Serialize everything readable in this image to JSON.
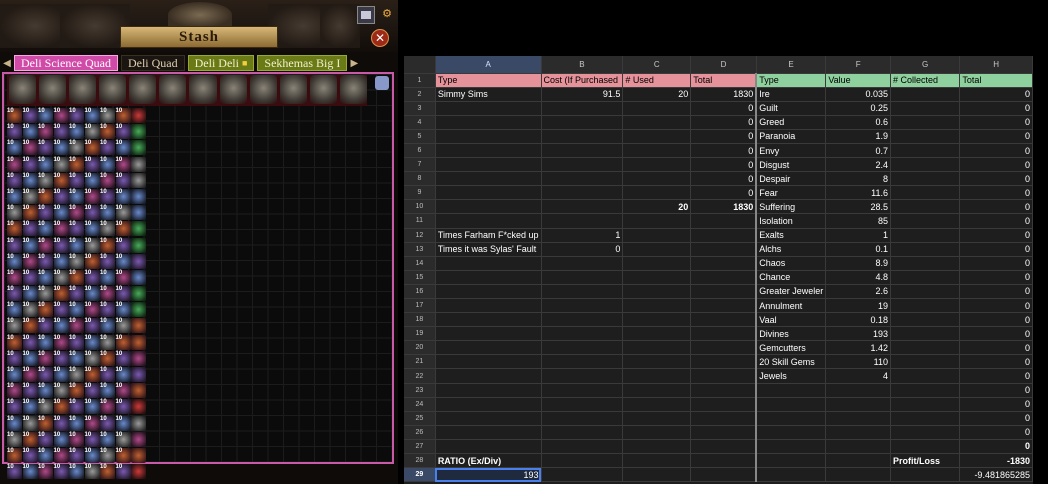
{
  "stash": {
    "title": "Stash",
    "tabs": [
      "Deli Science Quad",
      "Deli Quad",
      "Deli Deli",
      "Sekhemas Big I"
    ],
    "tab_colors": [
      "#d04aa8",
      "#1a1510",
      "#6a7a14",
      "#6a7a14"
    ],
    "close_icon": "close-icon",
    "item_label": "10"
  },
  "sheet": {
    "columns": [
      "",
      "A",
      "B",
      "C",
      "D",
      "E",
      "F",
      "G",
      "H"
    ],
    "selected_column": "A",
    "selected_row": "29",
    "rows": [
      {
        "n": "1",
        "a": "Type",
        "b": "Cost (If Purchased",
        "c": "# Used",
        "d": "Total",
        "e": "Type",
        "f": "Value",
        "g": "# Collected",
        "h": "Total"
      },
      {
        "n": "2",
        "a": "Simmy Sims",
        "b": "91.5",
        "c": "20",
        "d": "1830",
        "e": "Ire",
        "f": "0.035",
        "g": "",
        "h": "0"
      },
      {
        "n": "3",
        "a": "",
        "b": "",
        "c": "",
        "d": "0",
        "e": "Guilt",
        "f": "0.25",
        "g": "",
        "h": "0"
      },
      {
        "n": "4",
        "a": "",
        "b": "",
        "c": "",
        "d": "0",
        "e": "Greed",
        "f": "0.6",
        "g": "",
        "h": "0"
      },
      {
        "n": "5",
        "a": "",
        "b": "",
        "c": "",
        "d": "0",
        "e": "Paranoia",
        "f": "1.9",
        "g": "",
        "h": "0"
      },
      {
        "n": "6",
        "a": "",
        "b": "",
        "c": "",
        "d": "0",
        "e": "Envy",
        "f": "0.7",
        "g": "",
        "h": "0"
      },
      {
        "n": "7",
        "a": "",
        "b": "",
        "c": "",
        "d": "0",
        "e": "Disgust",
        "f": "2.4",
        "g": "",
        "h": "0"
      },
      {
        "n": "8",
        "a": "",
        "b": "",
        "c": "",
        "d": "0",
        "e": "Despair",
        "f": "8",
        "g": "",
        "h": "0"
      },
      {
        "n": "9",
        "a": "",
        "b": "",
        "c": "",
        "d": "0",
        "e": "Fear",
        "f": "11.6",
        "g": "",
        "h": "0"
      },
      {
        "n": "10",
        "a": "",
        "b": "",
        "c": "20",
        "d": "1830",
        "e": "Suffering",
        "f": "28.5",
        "g": "",
        "h": "0"
      },
      {
        "n": "11",
        "a": "",
        "b": "",
        "c": "",
        "d": "",
        "e": "Isolation",
        "f": "85",
        "g": "",
        "h": "0"
      },
      {
        "n": "12",
        "a": "Times Farham F*cked up",
        "b": "1",
        "c": "",
        "d": "",
        "e": "Exalts",
        "f": "1",
        "g": "",
        "h": "0"
      },
      {
        "n": "13",
        "a": "Times it was Sylas' Fault",
        "b": "0",
        "c": "",
        "d": "",
        "e": "Alchs",
        "f": "0.1",
        "g": "",
        "h": "0"
      },
      {
        "n": "14",
        "a": "",
        "b": "",
        "c": "",
        "d": "",
        "e": "Chaos",
        "f": "8.9",
        "g": "",
        "h": "0"
      },
      {
        "n": "15",
        "a": "",
        "b": "",
        "c": "",
        "d": "",
        "e": "Chance",
        "f": "4.8",
        "g": "",
        "h": "0"
      },
      {
        "n": "16",
        "a": "",
        "b": "",
        "c": "",
        "d": "",
        "e": "Greater Jeweler",
        "f": "2.6",
        "g": "",
        "h": "0"
      },
      {
        "n": "17",
        "a": "",
        "b": "",
        "c": "",
        "d": "",
        "e": "Annulment",
        "f": "19",
        "g": "",
        "h": "0"
      },
      {
        "n": "18",
        "a": "",
        "b": "",
        "c": "",
        "d": "",
        "e": "Vaal",
        "f": "0.18",
        "g": "",
        "h": "0"
      },
      {
        "n": "19",
        "a": "",
        "b": "",
        "c": "",
        "d": "",
        "e": "Divines",
        "f": "193",
        "g": "",
        "h": "0"
      },
      {
        "n": "20",
        "a": "",
        "b": "",
        "c": "",
        "d": "",
        "e": "Gemcutters",
        "f": "1.42",
        "g": "",
        "h": "0"
      },
      {
        "n": "21",
        "a": "",
        "b": "",
        "c": "",
        "d": "",
        "e": "20 Skill Gems",
        "f": "110",
        "g": "",
        "h": "0"
      },
      {
        "n": "22",
        "a": "",
        "b": "",
        "c": "",
        "d": "",
        "e": "Jewels",
        "f": "4",
        "g": "",
        "h": "0"
      },
      {
        "n": "23",
        "a": "",
        "b": "",
        "c": "",
        "d": "",
        "e": "",
        "f": "",
        "g": "",
        "h": "0"
      },
      {
        "n": "24",
        "a": "",
        "b": "",
        "c": "",
        "d": "",
        "e": "",
        "f": "",
        "g": "",
        "h": "0"
      },
      {
        "n": "25",
        "a": "",
        "b": "",
        "c": "",
        "d": "",
        "e": "",
        "f": "",
        "g": "",
        "h": "0"
      },
      {
        "n": "26",
        "a": "",
        "b": "",
        "c": "",
        "d": "",
        "e": "",
        "f": "",
        "g": "",
        "h": "0"
      },
      {
        "n": "27",
        "a": "",
        "b": "",
        "c": "",
        "d": "",
        "e": "",
        "f": "",
        "g": "",
        "h": "0"
      },
      {
        "n": "28",
        "a": "RATIO (Ex/Div)",
        "b": "",
        "c": "",
        "d": "",
        "e": "",
        "f": "",
        "g": "Profit/Loss",
        "h": "-1830"
      },
      {
        "n": "29",
        "a": "193",
        "b": "",
        "c": "",
        "d": "",
        "e": "",
        "f": "",
        "g": "",
        "h": "-9.481865285"
      }
    ],
    "header_colors": {
      "left": "#e6929a",
      "right": "#8fd19e"
    }
  }
}
